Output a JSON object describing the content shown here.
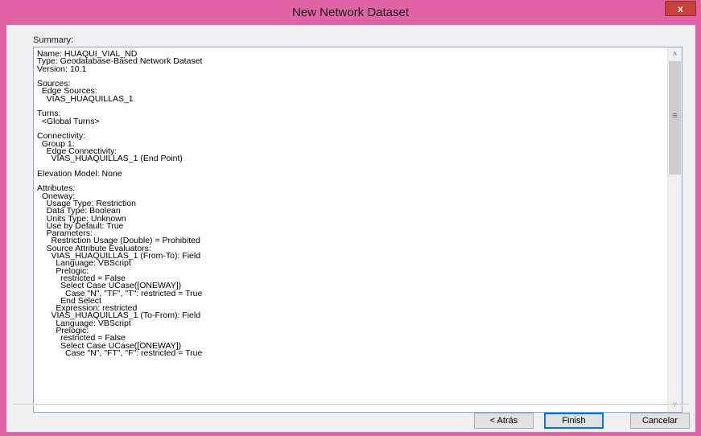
{
  "window": {
    "title": "New Network Dataset",
    "close_label": "x"
  },
  "summary": {
    "label": "Summary:",
    "lines": [
      "Name: HUAQUI_VIAL_ND",
      "Type: Geodatabase-Based Network Dataset",
      "Version: 10.1",
      "",
      "Sources:",
      "  Edge Sources:",
      "    VIAS_HUAQUILLAS_1",
      "",
      "Turns:",
      "  <Global Turns>",
      "",
      "Connectivity:",
      "  Group 1:",
      "    Edge Connectivity:",
      "      VIAS_HUAQUILLAS_1 (End Point)",
      "",
      "Elevation Model: None",
      "",
      "Attributes:",
      "  Oneway:",
      "    Usage Type: Restriction",
      "    Data Type: Boolean",
      "    Units Type: Unknown",
      "    Use by Default: True",
      "    Parameters:",
      "      Restriction Usage (Double) = Prohibited",
      "    Source Attribute Evaluators:",
      "      VIAS_HUAQUILLAS_1 (From-To): Field",
      "        Language: VBScript",
      "        Prelogic:",
      "          restricted = False",
      "          Select Case UCase([ONEWAY])",
      "            Case \"N\", \"TF\", \"T\": restricted = True",
      "          End Select",
      "        Expression: restricted",
      "      VIAS_HUAQUILLAS_1 (To-From): Field",
      "        Language: VBScript",
      "        Prelogic:",
      "          restricted = False",
      "          Select Case UCase([ONEWAY])",
      "            Case \"N\", \"FT\", \"F\": restricted = True"
    ]
  },
  "scrollbar": {
    "up_arrow_icon": "chevron-up-icon",
    "down_arrow_icon": "chevron-down-icon",
    "thumb_grip_icon": "grip-icon"
  },
  "buttons": {
    "back_label": "< Atrás",
    "finish_label": "Finish",
    "cancel_label": "Cancelar"
  }
}
